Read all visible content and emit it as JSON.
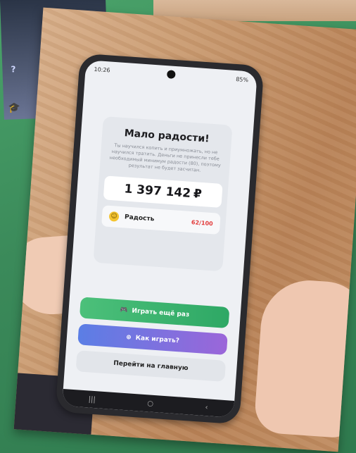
{
  "status_bar": {
    "time": "10:26",
    "battery": "85%"
  },
  "result": {
    "title": "Мало радости!",
    "description": "Ты научился копить и приумножать, но не научился тратить. Деньги не принесли тебе необходимый минимум радости (80), поэтому результат не будет засчитан.",
    "amount": "1 397 142",
    "currency": "₽",
    "joy_label": "Радость",
    "joy_value": "62/100"
  },
  "buttons": {
    "play_again": "Играть ещё раз",
    "how_to_play": "Как играть?",
    "go_home": "Перейти на главную"
  },
  "icons": {
    "joy": "smile-icon",
    "play": "gamepad-icon",
    "help": "help-icon"
  },
  "colors": {
    "play_button": "#2ea865",
    "how_button": "#7a72df",
    "joy_value": "#e23b3b"
  }
}
